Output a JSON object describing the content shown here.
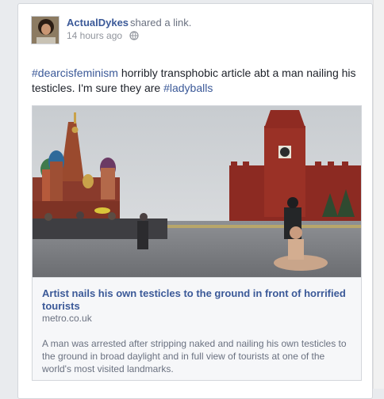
{
  "post": {
    "author": "ActualDykes",
    "action": "shared a link.",
    "timestamp": "14 hours ago",
    "text_tag1": "#dearcisfeminism",
    "text_body": " horribly transphobic article abt a man nailing his testicles. I'm sure they are ",
    "text_tag2": "#ladyballs"
  },
  "link": {
    "title": "Artist nails his own testicles to the ground in front of horrified tourists",
    "domain": "metro.co.uk",
    "description": "A man was arrested after stripping naked and nailing his own testicles to the ground in broad daylight and in full view of tourists at one of the world's most visited landmarks."
  },
  "icons": {
    "privacy": "globe-icon",
    "avatar": "avatar-photo"
  },
  "colors": {
    "link_blue": "#3b5998",
    "muted_text": "#90949c",
    "body_text": "#1d2129"
  }
}
